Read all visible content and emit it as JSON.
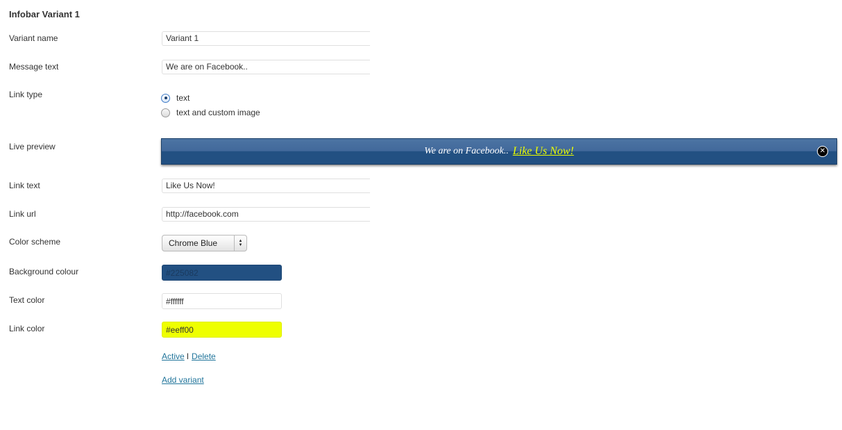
{
  "heading": "Infobar Variant 1",
  "fields": {
    "variant_name": {
      "label": "Variant name",
      "value": "Variant 1"
    },
    "message_text": {
      "label": "Message text",
      "value": "We are on Facebook.."
    },
    "link_type": {
      "label": "Link type",
      "options": [
        {
          "label": "text",
          "checked": true
        },
        {
          "label": "text and custom image",
          "checked": false
        }
      ]
    },
    "live_preview": {
      "label": "Live preview",
      "message": "We are on Facebook..",
      "link": "Like Us Now!",
      "close_icon": "close-icon"
    },
    "link_text": {
      "label": "Link text",
      "value": "Like Us Now!"
    },
    "link_url": {
      "label": "Link url",
      "value": "http://facebook.com"
    },
    "color_scheme": {
      "label": "Color scheme",
      "selected": "Chrome Blue"
    },
    "background_colour": {
      "label": "Background colour",
      "value": "#225082"
    },
    "text_color": {
      "label": "Text color",
      "value": "#ffffff"
    },
    "link_color": {
      "label": "Link color",
      "value": "#eeff00"
    }
  },
  "actions": {
    "active": "Active",
    "separator": "I",
    "delete": "Delete",
    "add_variant": "Add variant"
  },
  "colors": {
    "preview_background": "#225082",
    "preview_text": "#ffffff",
    "preview_link": "#eeff00",
    "wp_link": "#21759b"
  }
}
